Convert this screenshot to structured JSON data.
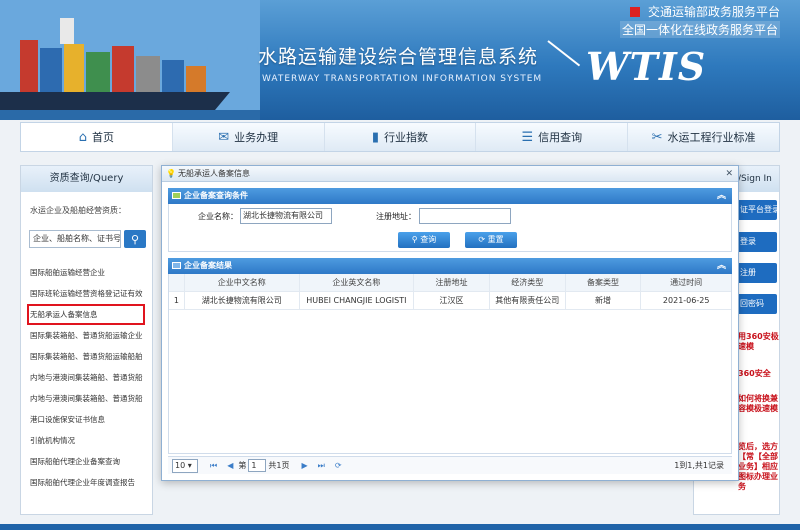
{
  "header": {
    "system_title": "水路运输建设综合管理信息系统",
    "system_subtitle": "WATERWAY TRANSPORTATION INFORMATION SYSTEM",
    "logo_text": "WTIS",
    "gov_line1": "交通运输部政务服务平台",
    "gov_line2": "全国一体化在线政务服务平台"
  },
  "nav": {
    "items": [
      {
        "label": "首页",
        "icon": "home-icon"
      },
      {
        "label": "业务办理",
        "icon": "handshake-icon"
      },
      {
        "label": "行业指数",
        "icon": "bar-chart-icon"
      },
      {
        "label": "信用查询",
        "icon": "document-icon"
      },
      {
        "label": "水运工程行业标准",
        "icon": "tools-icon"
      }
    ]
  },
  "sidebar": {
    "title": "资质查询/Query",
    "search_label": "水运企业及船舶经营资质：",
    "search_placeholder": "企业、船舶名称、证书号（",
    "links": [
      "国际船舶运输经营企业",
      "国际班轮运输经营资格登记证有效",
      "无船承运人备案信息",
      "国际集装箱船、普通货船运输企业",
      "国际集装箱船、普通货船运输船舶",
      "内地与港澳间集装箱船、普通货船",
      "内地与港澳间集装箱船、普通货船",
      "港口设施保安证书信息",
      "引航机构情况",
      "国际船舶代理企业备案查询",
      "国际船舶代理企业年度调查报告"
    ],
    "highlighted_index": 2
  },
  "right_panel": {
    "title": "/Sign In",
    "buttons": [
      "证平台登录",
      "登录",
      "注册",
      "回密码"
    ],
    "note1": "用360安极速模",
    "note2": "360安全",
    "note3": "如何将换兼容模极速模",
    "note4": "览后，选方【常【全部业务】相应图标办理业务"
  },
  "modal": {
    "title": "无船承运人备案信息",
    "query_section": "企业备案查询条件",
    "company_label": "企业名称：",
    "company_value": "湖北长捷物流有限公司",
    "address_label": "注册地址：",
    "address_value": "",
    "query_button": "查询",
    "reset_button": "重置",
    "result_section": "企业备案结果",
    "columns": [
      "",
      "企业中文名称",
      "企业英文名称",
      "注册地址",
      "经济类型",
      "备案类型",
      "通过时间"
    ],
    "rows": [
      [
        "1",
        "湖北长捷物流有限公司",
        "HUBEI CHANGJIE LOGISTI",
        "江汉区",
        "其他有限责任公司",
        "新增",
        "2021-06-25"
      ]
    ],
    "pager": {
      "page_size": "10",
      "page_prefix": "第",
      "page_value": "1",
      "page_suffix": "共1页",
      "summary": "1到1,共1记录"
    }
  },
  "colors": {
    "banner": "#2e79bd",
    "accent": "#2a78c5",
    "highlight": "#e0141e"
  }
}
